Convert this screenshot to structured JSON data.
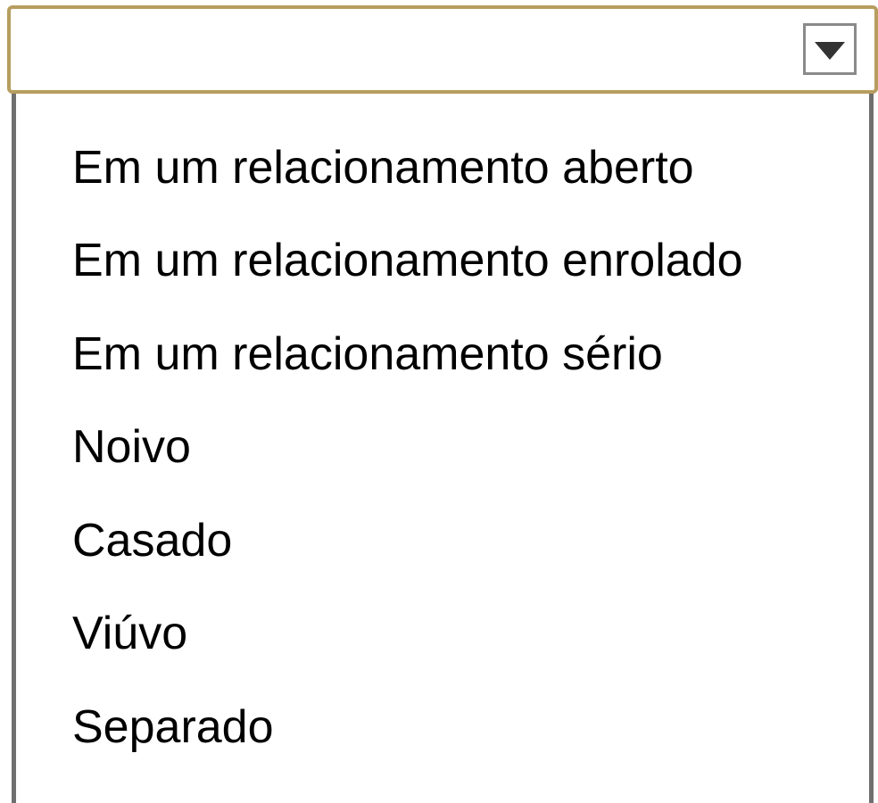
{
  "select": {
    "value": "",
    "accent_color": "#b79d5f",
    "toggle_icon": "triangle-down-icon"
  },
  "options": [
    "Em um relacionamento aberto",
    "Em um relacionamento enrolado",
    "Em um relacionamento sério",
    "Noivo",
    "Casado",
    "Viúvo",
    "Separado"
  ]
}
